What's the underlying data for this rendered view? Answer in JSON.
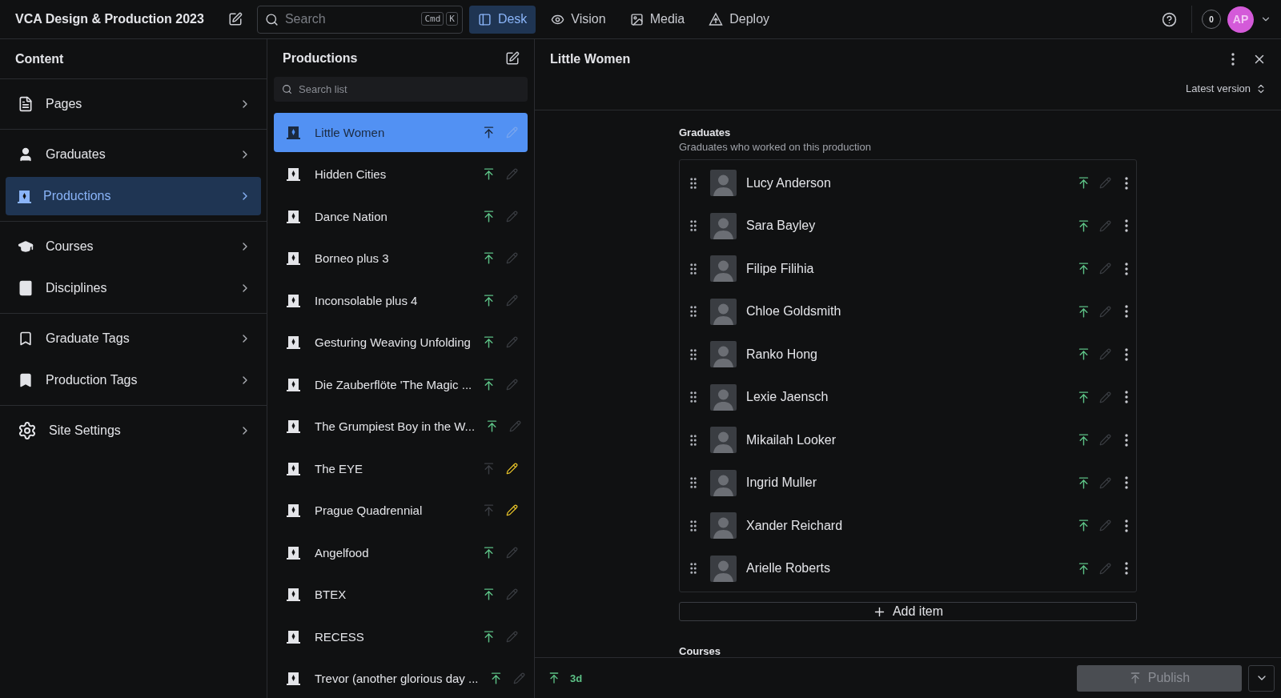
{
  "topbar": {
    "title": "VCA Design & Production 2023",
    "search": {
      "placeholder": "Search",
      "shortcut": [
        "Cmd",
        "K"
      ]
    },
    "tools": [
      {
        "kind": "desk",
        "label": "Desk",
        "selected": true
      },
      {
        "kind": "vision",
        "label": "Vision",
        "selected": false
      },
      {
        "kind": "media",
        "label": "Media",
        "selected": false
      },
      {
        "kind": "deploy",
        "label": "Deploy",
        "selected": false
      }
    ],
    "notifications": "0",
    "avatar": "AP"
  },
  "sidebar": {
    "title": "Content",
    "groups": [
      [
        {
          "kind": "page",
          "label": "Pages",
          "selected": false
        }
      ],
      [
        {
          "kind": "person",
          "label": "Graduates",
          "selected": false
        },
        {
          "kind": "production",
          "label": "Productions",
          "selected": true
        }
      ],
      [
        {
          "kind": "course",
          "label": "Courses",
          "selected": false
        },
        {
          "kind": "discipline",
          "label": "Disciplines",
          "selected": false
        }
      ],
      [
        {
          "kind": "tag-outline",
          "label": "Graduate Tags",
          "selected": false
        },
        {
          "kind": "tag",
          "label": "Production Tags",
          "selected": false
        }
      ],
      [
        {
          "kind": "settings",
          "label": "Site Settings",
          "selected": false
        }
      ]
    ]
  },
  "productions": {
    "title": "Productions",
    "search": {
      "placeholder": "Search list"
    },
    "items": [
      {
        "title": "Little Women",
        "selected": true,
        "published": true,
        "edited": false
      },
      {
        "title": "Hidden Cities",
        "selected": false,
        "published": true,
        "edited": false
      },
      {
        "title": "Dance Nation",
        "selected": false,
        "published": true,
        "edited": false
      },
      {
        "title": "Borneo plus 3",
        "selected": false,
        "published": true,
        "edited": false
      },
      {
        "title": "Inconsolable plus 4",
        "selected": false,
        "published": true,
        "edited": false
      },
      {
        "title": "Gesturing Weaving Unfolding",
        "selected": false,
        "published": true,
        "edited": false
      },
      {
        "title": "Die Zauberflöte 'The Magic ...",
        "selected": false,
        "published": true,
        "edited": false
      },
      {
        "title": "The Grumpiest Boy in the W...",
        "selected": false,
        "published": true,
        "edited": false
      },
      {
        "title": "The EYE",
        "selected": false,
        "published": false,
        "edited": true
      },
      {
        "title": "Prague Quadrennial",
        "selected": false,
        "published": false,
        "edited": true
      },
      {
        "title": "Angelfood",
        "selected": false,
        "published": true,
        "edited": false
      },
      {
        "title": "BTEX",
        "selected": false,
        "published": true,
        "edited": false
      },
      {
        "title": "RECESS",
        "selected": false,
        "published": true,
        "edited": false
      },
      {
        "title": "Trevor (another glorious day ...",
        "selected": false,
        "published": true,
        "edited": false
      }
    ]
  },
  "document": {
    "title": "Little Women",
    "version": "Latest version",
    "field": {
      "label": "Graduates",
      "description": "Graduates who worked on this production",
      "items": [
        {
          "name": "Lucy Anderson",
          "published": true,
          "edited": false
        },
        {
          "name": "Sara Bayley",
          "published": true,
          "edited": false
        },
        {
          "name": "Filipe Filihia",
          "published": true,
          "edited": false
        },
        {
          "name": "Chloe Goldsmith",
          "published": true,
          "edited": false
        },
        {
          "name": "Ranko Hong",
          "published": true,
          "edited": false
        },
        {
          "name": "Lexie Jaensch",
          "published": true,
          "edited": false
        },
        {
          "name": "Mikailah Looker",
          "published": true,
          "edited": false
        },
        {
          "name": "Ingrid Muller",
          "published": true,
          "edited": false
        },
        {
          "name": "Xander Reichard",
          "published": true,
          "edited": false
        },
        {
          "name": "Arielle Roberts",
          "published": true,
          "edited": false
        }
      ],
      "add_label": "Add item"
    },
    "next_field": "Courses",
    "footer": {
      "status": "3d",
      "publish": {
        "label": "Publish",
        "disabled": true
      }
    }
  }
}
